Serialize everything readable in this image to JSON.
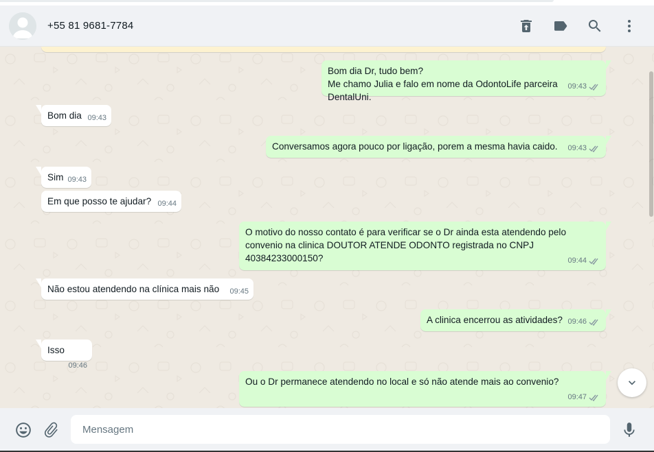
{
  "header": {
    "contact": "+55 81 9681-7784",
    "icons": [
      "delete-chat-icon",
      "label-icon",
      "search-icon",
      "menu-icon"
    ]
  },
  "messages": [
    {
      "dir": "out",
      "text": "Bom dia Dr, tudo bem?\nMe chamo Julia e falo em nome da OdontoLife parceira DentalUni.",
      "time": "09:43",
      "status": "read"
    },
    {
      "dir": "in",
      "text": "Bom dia",
      "time": "09:43"
    },
    {
      "dir": "out",
      "text": "Conversamos agora pouco por ligação, porem a mesma havia caido.",
      "time": "09:43",
      "status": "read"
    },
    {
      "dir": "in",
      "text": "Sim",
      "time": "09:43"
    },
    {
      "dir": "in",
      "text": "Em que posso te ajudar?",
      "time": "09:44"
    },
    {
      "dir": "out",
      "text": "O motivo do nosso contato é para verificar se o Dr ainda esta atendendo pelo\nconvenio na clinica DOUTOR ATENDE ODONTO registrada no CNPJ\n40384233000150?",
      "time": "09:44",
      "status": "read"
    },
    {
      "dir": "in",
      "text": "Não estou atendendo na clínica mais não",
      "time": "09:45"
    },
    {
      "dir": "out",
      "text": "A clinica encerrou as atividades?",
      "time": "09:46",
      "status": "read"
    },
    {
      "dir": "in",
      "text": "Isso",
      "time": "09:46"
    },
    {
      "dir": "out",
      "text": "Ou o Dr permanece atendendo no local e só não atende mais ao convenio?",
      "time": "09:47",
      "status": "read"
    }
  ],
  "composer": {
    "placeholder": "Mensagem",
    "icons": [
      "emoji-icon",
      "attach-icon",
      "mic-icon"
    ]
  },
  "colors": {
    "incoming": "#ffffff",
    "outgoing": "#d9fdd3",
    "chat_bg": "#efeae2",
    "header_bg": "#f0f2f5"
  }
}
